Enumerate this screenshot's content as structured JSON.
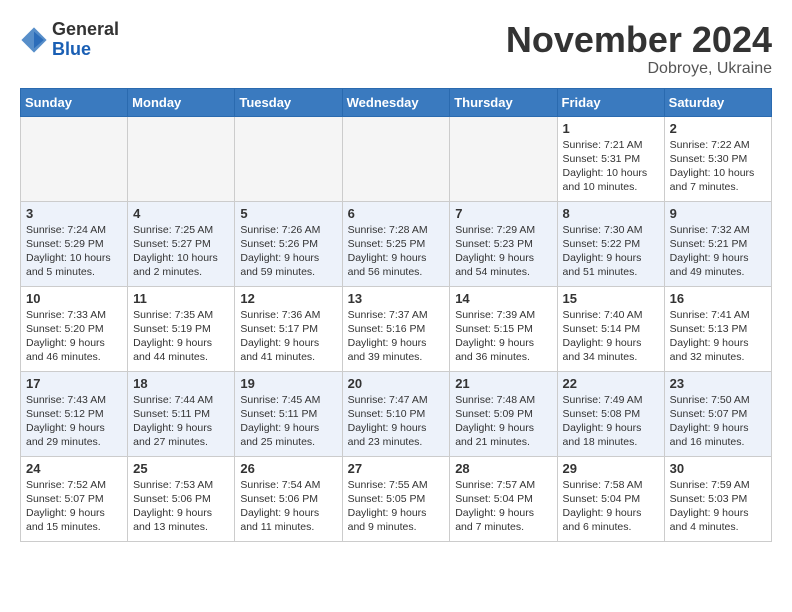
{
  "header": {
    "logo": {
      "general": "General",
      "blue": "Blue"
    },
    "month": "November 2024",
    "location": "Dobroye, Ukraine"
  },
  "weekdays": [
    "Sunday",
    "Monday",
    "Tuesday",
    "Wednesday",
    "Thursday",
    "Friday",
    "Saturday"
  ],
  "weeks": [
    [
      {
        "day": "",
        "info": ""
      },
      {
        "day": "",
        "info": ""
      },
      {
        "day": "",
        "info": ""
      },
      {
        "day": "",
        "info": ""
      },
      {
        "day": "",
        "info": ""
      },
      {
        "day": "1",
        "info": "Sunrise: 7:21 AM\nSunset: 5:31 PM\nDaylight: 10 hours and 10 minutes."
      },
      {
        "day": "2",
        "info": "Sunrise: 7:22 AM\nSunset: 5:30 PM\nDaylight: 10 hours and 7 minutes."
      }
    ],
    [
      {
        "day": "3",
        "info": "Sunrise: 7:24 AM\nSunset: 5:29 PM\nDaylight: 10 hours and 5 minutes."
      },
      {
        "day": "4",
        "info": "Sunrise: 7:25 AM\nSunset: 5:27 PM\nDaylight: 10 hours and 2 minutes."
      },
      {
        "day": "5",
        "info": "Sunrise: 7:26 AM\nSunset: 5:26 PM\nDaylight: 9 hours and 59 minutes."
      },
      {
        "day": "6",
        "info": "Sunrise: 7:28 AM\nSunset: 5:25 PM\nDaylight: 9 hours and 56 minutes."
      },
      {
        "day": "7",
        "info": "Sunrise: 7:29 AM\nSunset: 5:23 PM\nDaylight: 9 hours and 54 minutes."
      },
      {
        "day": "8",
        "info": "Sunrise: 7:30 AM\nSunset: 5:22 PM\nDaylight: 9 hours and 51 minutes."
      },
      {
        "day": "9",
        "info": "Sunrise: 7:32 AM\nSunset: 5:21 PM\nDaylight: 9 hours and 49 minutes."
      }
    ],
    [
      {
        "day": "10",
        "info": "Sunrise: 7:33 AM\nSunset: 5:20 PM\nDaylight: 9 hours and 46 minutes."
      },
      {
        "day": "11",
        "info": "Sunrise: 7:35 AM\nSunset: 5:19 PM\nDaylight: 9 hours and 44 minutes."
      },
      {
        "day": "12",
        "info": "Sunrise: 7:36 AM\nSunset: 5:17 PM\nDaylight: 9 hours and 41 minutes."
      },
      {
        "day": "13",
        "info": "Sunrise: 7:37 AM\nSunset: 5:16 PM\nDaylight: 9 hours and 39 minutes."
      },
      {
        "day": "14",
        "info": "Sunrise: 7:39 AM\nSunset: 5:15 PM\nDaylight: 9 hours and 36 minutes."
      },
      {
        "day": "15",
        "info": "Sunrise: 7:40 AM\nSunset: 5:14 PM\nDaylight: 9 hours and 34 minutes."
      },
      {
        "day": "16",
        "info": "Sunrise: 7:41 AM\nSunset: 5:13 PM\nDaylight: 9 hours and 32 minutes."
      }
    ],
    [
      {
        "day": "17",
        "info": "Sunrise: 7:43 AM\nSunset: 5:12 PM\nDaylight: 9 hours and 29 minutes."
      },
      {
        "day": "18",
        "info": "Sunrise: 7:44 AM\nSunset: 5:11 PM\nDaylight: 9 hours and 27 minutes."
      },
      {
        "day": "19",
        "info": "Sunrise: 7:45 AM\nSunset: 5:11 PM\nDaylight: 9 hours and 25 minutes."
      },
      {
        "day": "20",
        "info": "Sunrise: 7:47 AM\nSunset: 5:10 PM\nDaylight: 9 hours and 23 minutes."
      },
      {
        "day": "21",
        "info": "Sunrise: 7:48 AM\nSunset: 5:09 PM\nDaylight: 9 hours and 21 minutes."
      },
      {
        "day": "22",
        "info": "Sunrise: 7:49 AM\nSunset: 5:08 PM\nDaylight: 9 hours and 18 minutes."
      },
      {
        "day": "23",
        "info": "Sunrise: 7:50 AM\nSunset: 5:07 PM\nDaylight: 9 hours and 16 minutes."
      }
    ],
    [
      {
        "day": "24",
        "info": "Sunrise: 7:52 AM\nSunset: 5:07 PM\nDaylight: 9 hours and 15 minutes."
      },
      {
        "day": "25",
        "info": "Sunrise: 7:53 AM\nSunset: 5:06 PM\nDaylight: 9 hours and 13 minutes."
      },
      {
        "day": "26",
        "info": "Sunrise: 7:54 AM\nSunset: 5:06 PM\nDaylight: 9 hours and 11 minutes."
      },
      {
        "day": "27",
        "info": "Sunrise: 7:55 AM\nSunset: 5:05 PM\nDaylight: 9 hours and 9 minutes."
      },
      {
        "day": "28",
        "info": "Sunrise: 7:57 AM\nSunset: 5:04 PM\nDaylight: 9 hours and 7 minutes."
      },
      {
        "day": "29",
        "info": "Sunrise: 7:58 AM\nSunset: 5:04 PM\nDaylight: 9 hours and 6 minutes."
      },
      {
        "day": "30",
        "info": "Sunrise: 7:59 AM\nSunset: 5:03 PM\nDaylight: 9 hours and 4 minutes."
      }
    ]
  ]
}
